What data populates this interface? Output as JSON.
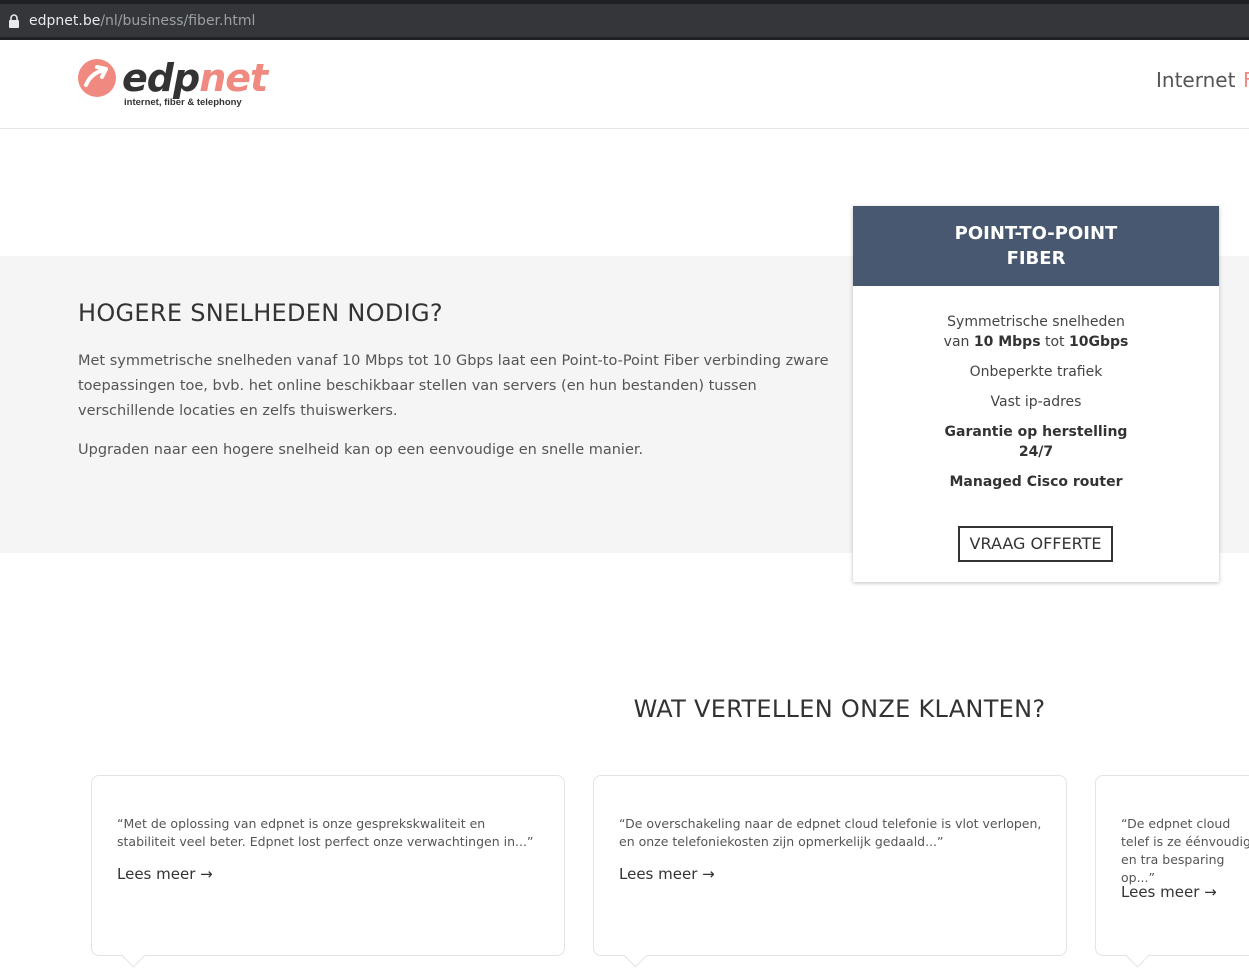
{
  "browser": {
    "domain": "edpnet.be",
    "path": "/nl/business/fiber.html"
  },
  "header": {
    "logo_prefix": "edp",
    "logo_suffix": "net",
    "logo_tagline": "internet, fiber & telephony",
    "nav": [
      "Internet",
      "F"
    ]
  },
  "colors": {
    "brand_accent": "#f08a80",
    "card_header": "#475870"
  },
  "intro": {
    "title": "HOGERE SNELHEDEN NODIG?",
    "paragraph1": "Met symmetrische snelheden vanaf 10 Mbps tot 10 Gbps laat een Point-to-Point Fiber verbinding zware toepassingen toe, bvb. het online beschikbaar stellen van servers (en hun bestanden) tussen verschillende locaties en zelfs thuiswerkers.",
    "paragraph2": "Upgraden naar een hogere snelheid kan op een eenvoudige en snelle manier."
  },
  "product_card": {
    "title_line1": "POINT-TO-POINT",
    "title_line2": "FIBER",
    "speed_line1": "Symmetrische snelheden",
    "speed_van": "van",
    "speed_from": "10 Mbps",
    "speed_tot": "tot",
    "speed_to": "10Gbps",
    "feature_traffic": "Onbeperkte trafiek",
    "feature_ip": "Vast ip-adres",
    "feature_repair_line1": "Garantie op herstelling",
    "feature_repair_line2": "24/7",
    "feature_router": "Managed Cisco router",
    "button_label": "VRAAG OFFERTE"
  },
  "testimonials": {
    "title": "WAT VERTELLEN ONZE KLANTEN?",
    "read_more": "Lees meer →",
    "items": [
      {
        "quote": "“Met de oplossing van edpnet is onze gesprekskwaliteit en stabiliteit veel beter. Edpnet lost perfect onze verwachtingen in...”"
      },
      {
        "quote": "“De overschakeling naar de edpnet cloud telefonie is vlot verlopen, en onze telefoniekosten zijn opmerkelijk gedaald...”"
      },
      {
        "quote": "“De edpnet cloud telef is ze éénvoudig en tra besparing op...”"
      }
    ]
  }
}
